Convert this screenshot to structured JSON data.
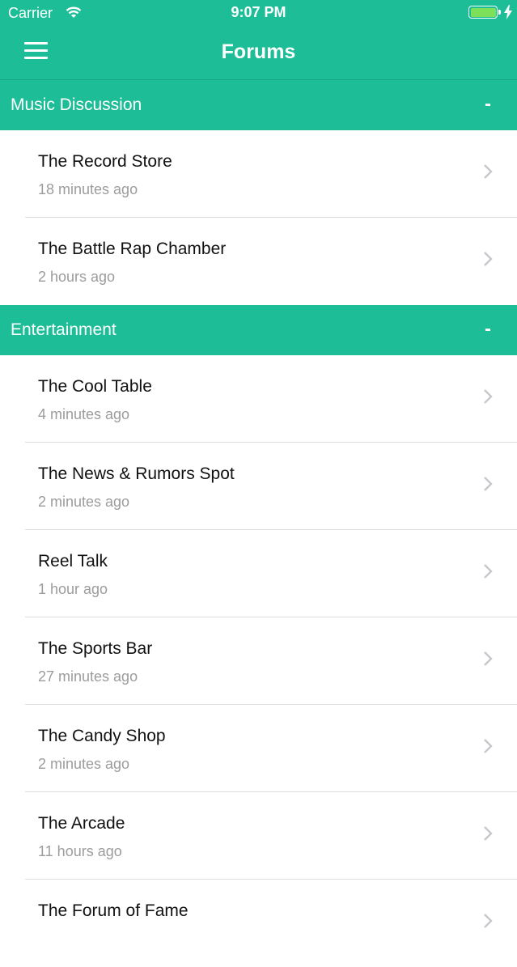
{
  "status_bar": {
    "carrier": "Carrier",
    "time": "9:07 PM"
  },
  "nav": {
    "title": "Forums",
    "menu_icon": "hamburger-menu-icon"
  },
  "colors": {
    "accent": "#1dbd97",
    "subtitle": "#9c9c9c",
    "chevron": "#c7c7cc"
  },
  "sections": [
    {
      "title": "Music Discussion",
      "toggle": "-",
      "rows": [
        {
          "title": "The Record Store",
          "time": "18 minutes ago"
        },
        {
          "title": "The Battle Rap Chamber",
          "time": "2 hours ago"
        }
      ]
    },
    {
      "title": "Entertainment",
      "toggle": "-",
      "rows": [
        {
          "title": "The Cool Table",
          "time": "4 minutes ago"
        },
        {
          "title": "The News & Rumors Spot",
          "time": "2 minutes ago"
        },
        {
          "title": "Reel Talk",
          "time": "1 hour ago"
        },
        {
          "title": "The Sports Bar",
          "time": "27 minutes ago"
        },
        {
          "title": "The Candy Shop",
          "time": "2 minutes ago"
        },
        {
          "title": "The Arcade",
          "time": "11 hours ago"
        },
        {
          "title": "The Forum of Fame",
          "time": ""
        }
      ]
    }
  ]
}
